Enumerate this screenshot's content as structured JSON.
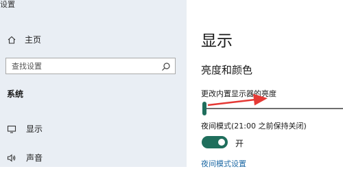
{
  "window": {
    "title": "设置"
  },
  "sidebar": {
    "home_label": "主页",
    "search_placeholder": "查找设置",
    "section_label": "系统",
    "items": [
      {
        "label": "显示",
        "icon": "monitor-icon"
      },
      {
        "label": "声音",
        "icon": "speaker-icon"
      }
    ]
  },
  "main": {
    "title": "显示",
    "section_title": "亮度和颜色",
    "brightness_label": "更改内置显示器的亮度",
    "brightness_value": 0,
    "night_light_label": "夜间模式(21:00 之前保持关闭)",
    "night_light_state": "开",
    "night_light_on": true,
    "night_light_link": "夜间模式设置"
  },
  "colors": {
    "sidebar_bg": "#e9eef4",
    "accent": "#1f6e5c",
    "link": "#1f6aa5",
    "annotation_arrow": "#e53935"
  }
}
